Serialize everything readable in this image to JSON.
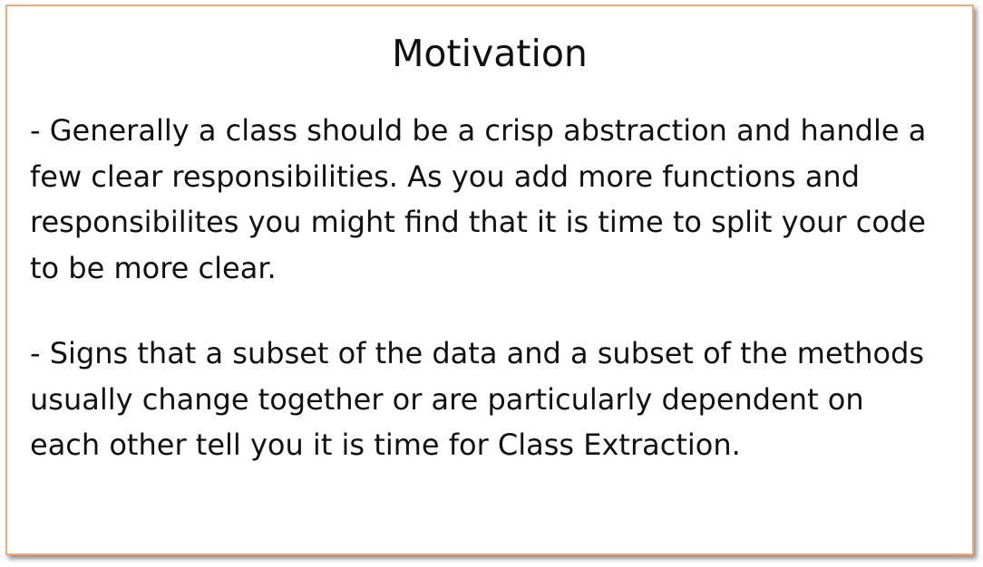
{
  "slide": {
    "title": "Motivation",
    "paragraphs": [
      "- Generally a class should be a crisp abstraction and handle a few clear responsibilities. As you add more functions and responsibilites you might find that it is time to split your code to be more clear.",
      "- Signs that a subset of the data and a subset of the methods usually change together or are particularly dependent on each other tell you it is time for Class Extraction."
    ]
  },
  "colors": {
    "border": "#f0a878",
    "text": "#111111",
    "background": "#ffffff"
  }
}
